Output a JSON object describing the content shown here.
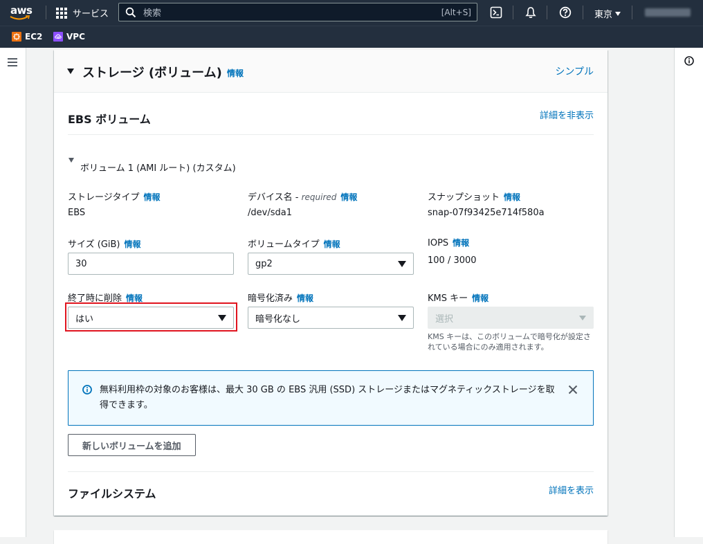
{
  "nav": {
    "logo_text": "aws",
    "services_label": "サービス",
    "search_placeholder": "検索",
    "search_shortcut": "[Alt+S]",
    "region": "東京"
  },
  "favorites": [
    {
      "label": "EC2",
      "color": "#ec7211"
    },
    {
      "label": "VPC",
      "color": "#8c4fff"
    }
  ],
  "section": {
    "title": "ストレージ (ボリューム)",
    "info": "情報",
    "simple_link": "シンプル"
  },
  "ebs": {
    "title": "EBS ボリューム",
    "hide_details": "詳細を非表示",
    "volume_label": "ボリューム 1 (AMI ルート) (カスタム)"
  },
  "fields": {
    "storage_type": {
      "label": "ストレージタイプ",
      "info": "情報",
      "value": "EBS"
    },
    "device_name": {
      "label": "デバイス名 - ",
      "required": "required",
      "info": "情報",
      "value": "/dev/sda1"
    },
    "snapshot": {
      "label": "スナップショット",
      "info": "情報",
      "value": "snap-07f93425e714f580a"
    },
    "size": {
      "label": "サイズ (GiB)",
      "info": "情報",
      "value": "30"
    },
    "volume_type": {
      "label": "ボリュームタイプ",
      "info": "情報",
      "value": "gp2"
    },
    "iops": {
      "label": "IOPS",
      "info": "情報",
      "value": "100 / 3000"
    },
    "delete_on_termination": {
      "label": "終了時に削除",
      "info": "情報",
      "value": "はい"
    },
    "encrypted": {
      "label": "暗号化済み",
      "info": "情報",
      "value": "暗号化なし"
    },
    "kms_key": {
      "label": "KMS キー",
      "info": "情報",
      "value": "選択",
      "note": "KMS キーは、このボリュームで暗号化が設定されている場合にのみ適用されます。"
    }
  },
  "alert": {
    "text": "無料利用枠の対象のお客様は、最大 30 GB の EBS 汎用 (SSD) ストレージまたはマグネティックストレージを取得できます。"
  },
  "add_volume_button": "新しいボリュームを追加",
  "filesystem": {
    "title": "ファイルシステム",
    "show_details": "詳細を表示"
  },
  "colors": {
    "nav_bg": "#232f3e",
    "link": "#0073bb",
    "highlight": "#e0141e"
  }
}
